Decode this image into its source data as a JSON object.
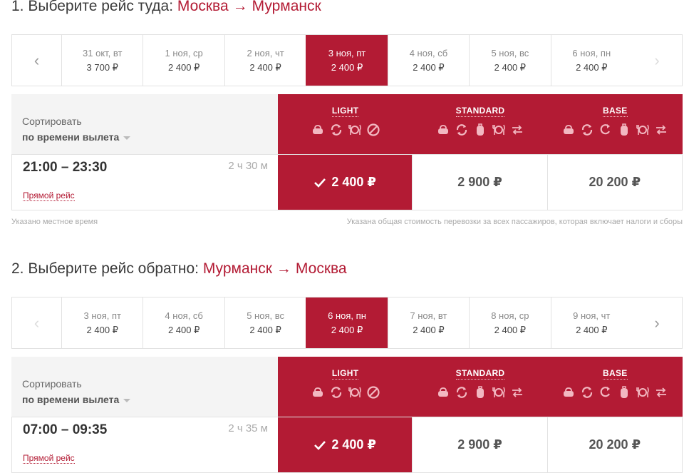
{
  "section1": {
    "heading_prefix": "1. Выберите рейс туда:",
    "origin": "Москва",
    "destination": "Мурманск",
    "dates": [
      {
        "date": "31 окт, вт",
        "price": "3 700 ₽",
        "active": false
      },
      {
        "date": "1 ноя, ср",
        "price": "2 400 ₽",
        "active": false
      },
      {
        "date": "2 ноя, чт",
        "price": "2 400 ₽",
        "active": false
      },
      {
        "date": "3 ноя, пт",
        "price": "2 400 ₽",
        "active": true
      },
      {
        "date": "4 ноя, сб",
        "price": "2 400 ₽",
        "active": false
      },
      {
        "date": "5 ноя, вс",
        "price": "2 400 ₽",
        "active": false
      },
      {
        "date": "6 ноя, пн",
        "price": "2 400 ₽",
        "active": false
      }
    ],
    "sort_label": "Сортировать",
    "sort_value": "по времени вылета",
    "fares": [
      "LIGHT",
      "STANDARD",
      "BASE"
    ],
    "flight": {
      "time": "21:00 – 23:30",
      "duration": "2 ч 30 м",
      "type": "Прямой рейс"
    },
    "prices": [
      "2 400 ₽",
      "2 900 ₽",
      "20 200 ₽"
    ],
    "note_left": "Указано местное время",
    "note_right": "Указана общая стоимость перевозки за всех пассажиров, которая включает налоги и сборы"
  },
  "section2": {
    "heading_prefix": "2. Выберите рейс обратно:",
    "origin": "Мурманск",
    "destination": "Москва",
    "dates": [
      {
        "date": "3 ноя, пт",
        "price": "2 400 ₽",
        "active": false
      },
      {
        "date": "4 ноя, сб",
        "price": "2 400 ₽",
        "active": false
      },
      {
        "date": "5 ноя, вс",
        "price": "2 400 ₽",
        "active": false
      },
      {
        "date": "6 ноя, пн",
        "price": "2 400 ₽",
        "active": true
      },
      {
        "date": "7 ноя, вт",
        "price": "2 400 ₽",
        "active": false
      },
      {
        "date": "8 ноя, ср",
        "price": "2 400 ₽",
        "active": false
      },
      {
        "date": "9 ноя, чт",
        "price": "2 400 ₽",
        "active": false
      }
    ],
    "sort_label": "Сортировать",
    "sort_value": "по времени вылета",
    "fares": [
      "LIGHT",
      "STANDARD",
      "BASE"
    ],
    "flight": {
      "time": "07:00 – 09:35",
      "duration": "2 ч 35 м",
      "type": "Прямой рейс"
    },
    "prices": [
      "2 400 ₽",
      "2 900 ₽",
      "20 200 ₽"
    ]
  },
  "fare_icons": {
    "light": [
      "bag-icon",
      "exchange-icon",
      "meal-icon",
      "no-refund-icon"
    ],
    "standard": [
      "bag-icon",
      "exchange-icon",
      "luggage-icon",
      "meal-icon",
      "refund-icon"
    ],
    "base": [
      "bag-icon",
      "exchange-icon",
      "free-change-icon",
      "luggage-icon",
      "meal-icon",
      "refund-icon"
    ]
  },
  "colors": {
    "accent": "#b31b34",
    "icon": "#f2b8c1"
  }
}
